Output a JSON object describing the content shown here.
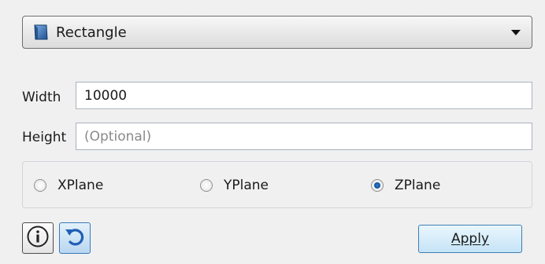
{
  "shape_selector": {
    "icon": "rectangle-shape-icon",
    "selected": "Rectangle",
    "accent_color": "#3a6fb0"
  },
  "width": {
    "label": "Width",
    "value": "10000"
  },
  "height": {
    "label": "Height",
    "placeholder": "(Optional)"
  },
  "plane": {
    "options": [
      "XPlane",
      "YPlane",
      "ZPlane"
    ],
    "selected": "ZPlane"
  },
  "toolbar": {
    "info_icon": "info-icon",
    "reset_icon": "undo-icon",
    "apply_label": "Apply"
  }
}
